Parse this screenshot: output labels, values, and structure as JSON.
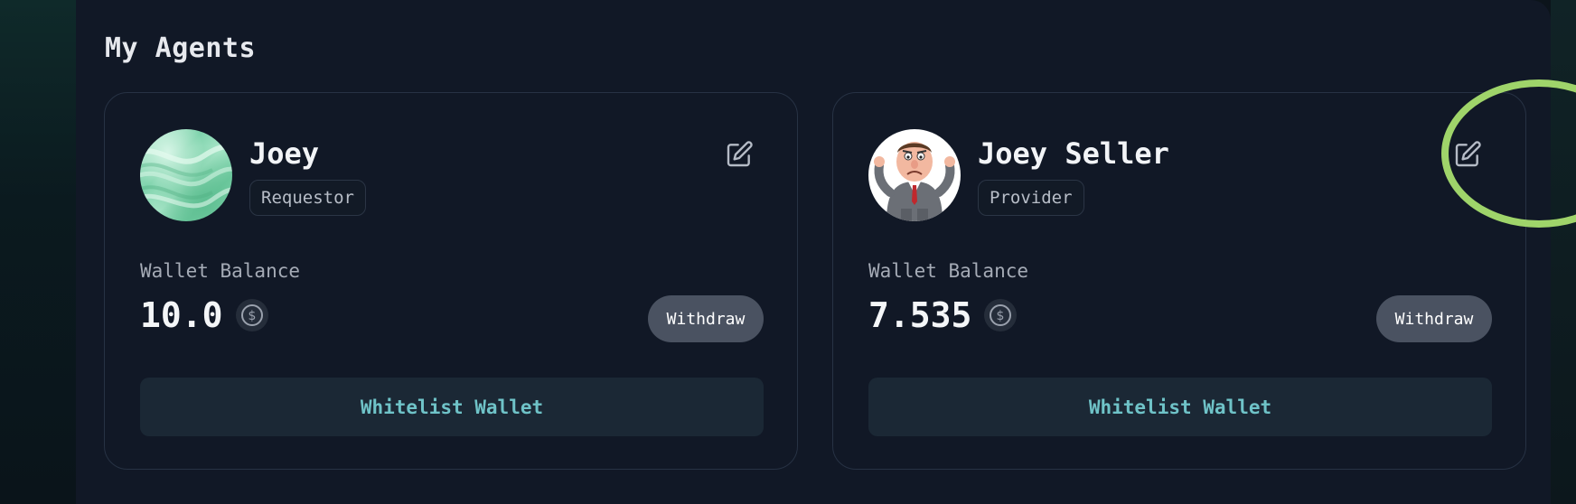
{
  "section": {
    "title": "My Agents"
  },
  "agents": [
    {
      "name": "Joey",
      "role": "Requestor",
      "avatar": "green-silk-avatar",
      "wallet_label": "Wallet Balance",
      "balance": "10.0",
      "currency_icon": "usdc-icon",
      "withdraw_label": "Withdraw",
      "whitelist_label": "Whitelist Wallet",
      "edit_icon": "edit-icon"
    },
    {
      "name": "Joey Seller",
      "role": "Provider",
      "avatar": "cartoon-businessman-avatar",
      "wallet_label": "Wallet Balance",
      "balance": "7.535",
      "currency_icon": "usdc-icon",
      "withdraw_label": "Withdraw",
      "whitelist_label": "Whitelist Wallet",
      "edit_icon": "edit-icon"
    }
  ],
  "annotation": {
    "shape": "circle",
    "color": "#9fd46a",
    "target": "edit-icon of Joey Seller card"
  },
  "colors": {
    "panel": "#111826",
    "card_border": "#273244",
    "withdraw_button": "#4a5261",
    "whitelist_button": "#1b2835",
    "whitelist_text": "#6fc3c8"
  }
}
